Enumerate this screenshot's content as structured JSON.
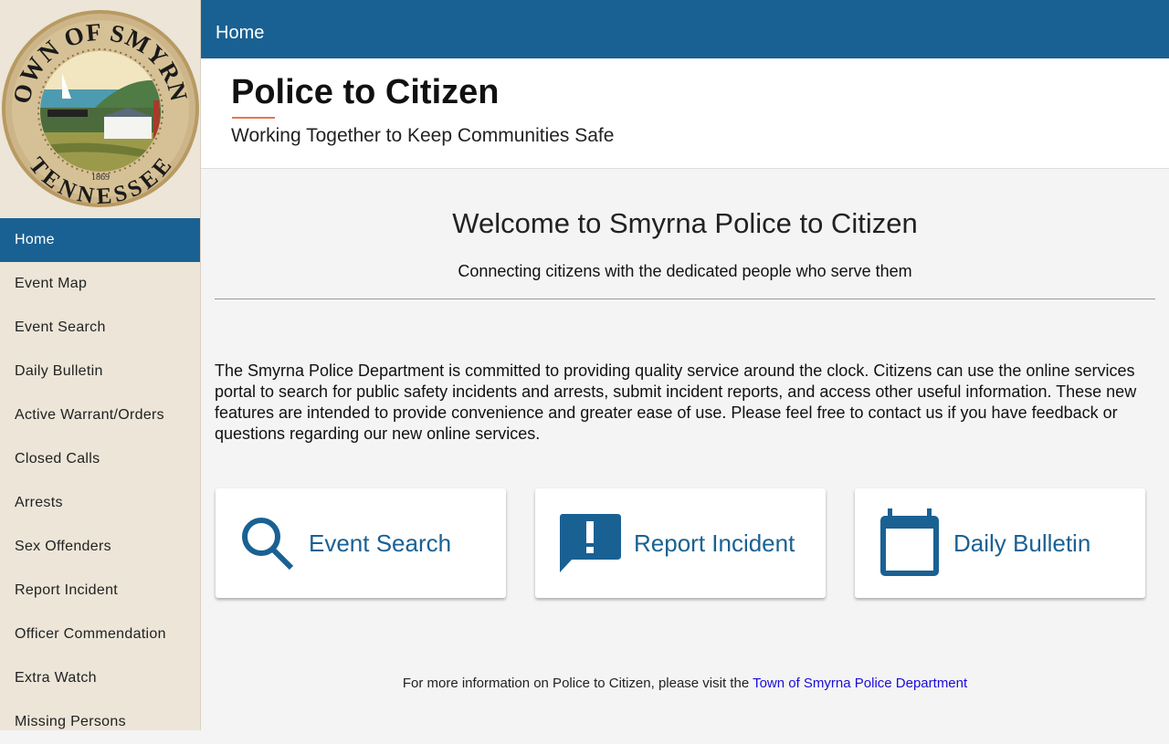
{
  "logo": {
    "top_text": "TOWN OF SMYRNA",
    "bottom_text": "TENNESSEE",
    "year": "1869"
  },
  "topbar": {
    "title": "Home"
  },
  "header": {
    "title": "Police to Citizen",
    "subtitle": "Working Together to Keep Communities Safe"
  },
  "sidebar": {
    "items": [
      {
        "label": "Home",
        "active": true
      },
      {
        "label": "Event Map"
      },
      {
        "label": "Event Search"
      },
      {
        "label": "Daily Bulletin"
      },
      {
        "label": "Active Warrant/Orders"
      },
      {
        "label": "Closed Calls"
      },
      {
        "label": "Arrests"
      },
      {
        "label": "Sex Offenders"
      },
      {
        "label": "Report Incident"
      },
      {
        "label": "Officer Commendation"
      },
      {
        "label": "Extra Watch"
      },
      {
        "label": "Missing Persons"
      }
    ]
  },
  "main": {
    "welcome": "Welcome to Smyrna Police to Citizen",
    "tagline": "Connecting citizens with the dedicated people who serve them",
    "intro": "The Smyrna Police Department is committed to providing quality service around the clock. Citizens can use the online services portal to search for public safety incidents and arrests, submit incident reports, and access other useful information. These new features are intended to provide convenience and greater ease of use. Please feel free to contact us if you have feedback or questions regarding our new online services.",
    "cards": [
      {
        "label": "Event Search",
        "icon": "search-icon"
      },
      {
        "label": "Report Incident",
        "icon": "alert-message-icon"
      },
      {
        "label": "Daily Bulletin",
        "icon": "calendar-icon"
      }
    ],
    "footer_text": "For more information on Police to Citizen, please visit the ",
    "footer_link": "Town of Smyrna Police Department"
  },
  "colors": {
    "primary": "#1a6193",
    "accent": "#e0794a",
    "sidebar": "#ece5d8"
  }
}
